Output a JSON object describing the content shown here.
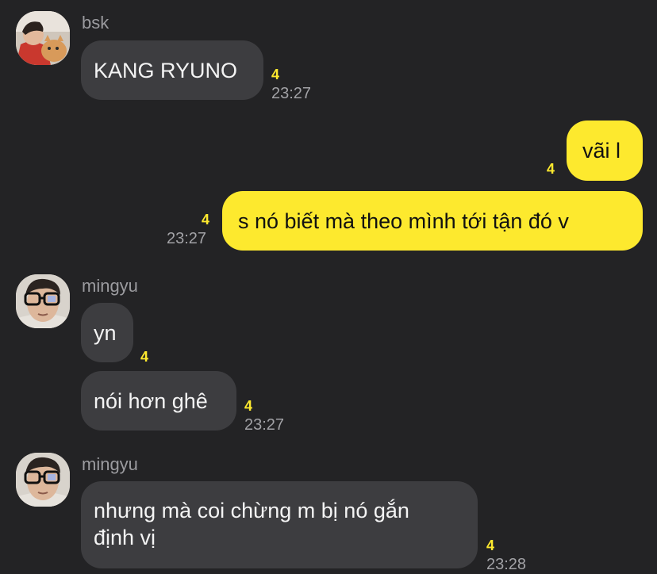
{
  "messages": [
    {
      "sender": "bsk",
      "text": "KANG RYUNO",
      "unread": "4",
      "time": "23:27"
    },
    {
      "text": "vãi l",
      "unread": "4"
    },
    {
      "text": "s nó biết mà theo mình tới tận đó v",
      "unread": "4",
      "time": "23:27"
    },
    {
      "sender": "mingyu",
      "text": "yn",
      "unread": "4"
    },
    {
      "text": "nói hơn ghê",
      "unread": "4",
      "time": "23:27"
    },
    {
      "sender": "mingyu",
      "lines": [
        "nhưng mà coi chừng m bị nó gắn",
        "định vị"
      ],
      "unread": "4",
      "time": "23:28"
    }
  ],
  "colors": {
    "background": "#232325",
    "incoming_bubble": "#3d3d40",
    "outgoing_bubble": "#fde92e",
    "unread_count": "#fde92e",
    "meta_text": "#a2a2a6"
  },
  "icons": {
    "avatar_bsk": "profile-photo-icon",
    "avatar_mingyu": "profile-photo-icon"
  }
}
